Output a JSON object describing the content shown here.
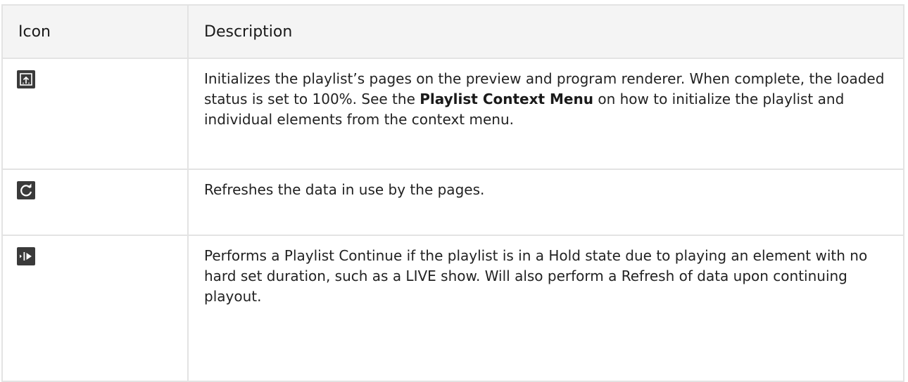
{
  "table": {
    "headers": {
      "icon": "Icon",
      "description": "Description"
    },
    "rows": [
      {
        "icon": "initialize-playlist-icon",
        "description_before": "Initializes the playlist’s pages on the preview and program renderer. When complete, the loaded status is set to 100%. See the ",
        "description_link": "Playlist Context Menu",
        "description_after": " on how to initialize the playlist and individual elements from the context menu."
      },
      {
        "icon": "refresh-icon",
        "description": "Refreshes the data in use by the pages."
      },
      {
        "icon": "continue-icon",
        "description": "Performs a Playlist Continue if the playlist is in a Hold state due to playing an element with no hard set duration, such as a LIVE show. Will also perform a Refresh of data upon continuing playout."
      }
    ]
  },
  "colors": {
    "icon_background": "#3a3a3a",
    "icon_foreground": "#ffffff",
    "header_background": "#f4f4f4",
    "border": "#e3e3e3"
  }
}
